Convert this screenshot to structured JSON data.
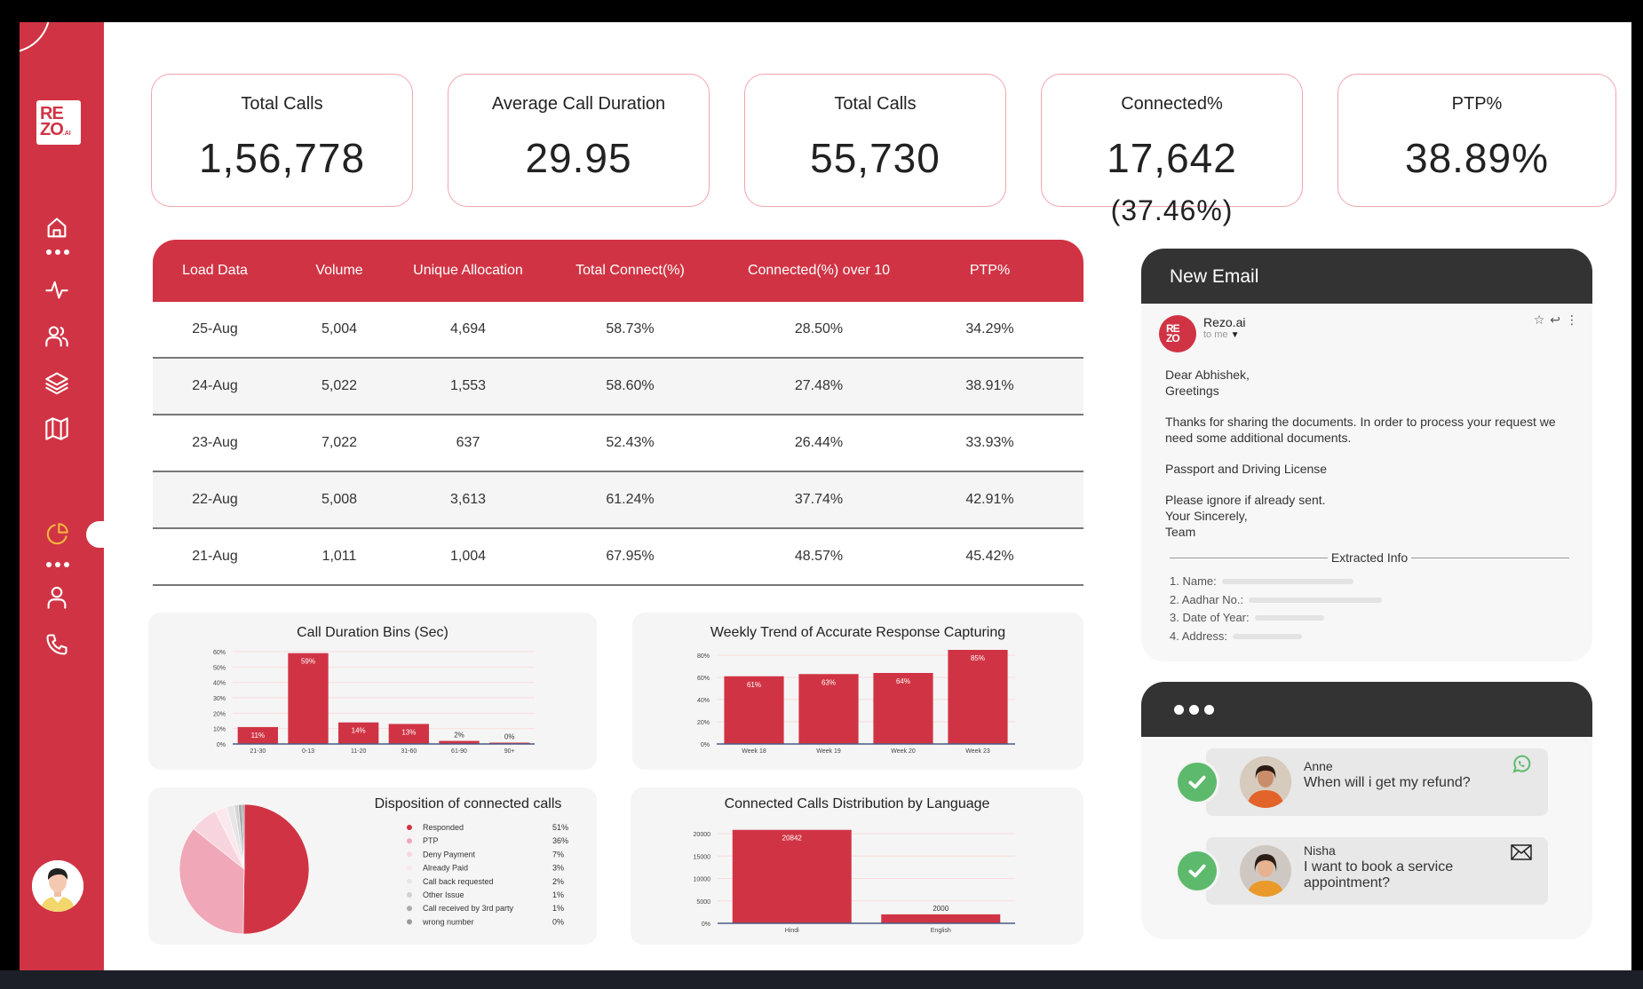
{
  "brand": {
    "logo_line1": "RE",
    "logo_line2": "ZO",
    "logo_suffix": ".AI"
  },
  "sidebar": {
    "items": [
      {
        "name": "home",
        "icon": "home-icon"
      },
      {
        "name": "more-1",
        "icon": "more-dots-icon"
      },
      {
        "name": "activity",
        "icon": "activity-pulse-icon"
      },
      {
        "name": "users",
        "icon": "users-icon"
      },
      {
        "name": "layers",
        "icon": "layers-icon"
      },
      {
        "name": "map",
        "icon": "map-icon"
      },
      {
        "name": "analytics",
        "icon": "pie-chart-icon",
        "active": true
      },
      {
        "name": "more-2",
        "icon": "more-dots-icon"
      },
      {
        "name": "profile",
        "icon": "user-icon"
      },
      {
        "name": "calls",
        "icon": "phone-icon"
      }
    ],
    "active_color": "#f5b640"
  },
  "kpis": [
    {
      "title": "Total Calls",
      "value": "1,56,778",
      "extra": ""
    },
    {
      "title": "Average Call Duration",
      "value": "29.95",
      "extra": ""
    },
    {
      "title": "Total Calls",
      "value": "55,730",
      "extra": ""
    },
    {
      "title": "Connected%",
      "value": "17,642",
      "extra": "(37.46%)"
    },
    {
      "title": "PTP%",
      "value": "38.89%",
      "extra": ""
    }
  ],
  "table": {
    "headers": [
      "Load Data",
      "Volume",
      "Unique Allocation",
      "Total Connect(%)",
      "Connected(%) over 10",
      "PTP%"
    ],
    "rows": [
      [
        "25-Aug",
        "5,004",
        "4,694",
        "58.73%",
        "28.50%",
        "34.29%"
      ],
      [
        "24-Aug",
        "5,022",
        "1,553",
        "58.60%",
        "27.48%",
        "38.91%"
      ],
      [
        "23-Aug",
        "7,022",
        "637",
        "52.43%",
        "26.44%",
        "33.93%"
      ],
      [
        "22-Aug",
        "5,008",
        "3,613",
        "61.24%",
        "37.74%",
        "42.91%"
      ],
      [
        "21-Aug",
        "1,011",
        "1,004",
        "67.95%",
        "48.57%",
        "45.42%"
      ]
    ]
  },
  "chart_data": [
    {
      "type": "bar",
      "title": "Call Duration Bins (Sec)",
      "categories": [
        "21-30",
        "0-13",
        "11-20",
        "31-60",
        "61-90",
        "90+"
      ],
      "values": [
        11,
        59,
        14,
        13,
        2,
        0
      ],
      "value_labels": [
        "11%",
        "59%",
        "14%",
        "13%",
        "2%",
        "0%"
      ],
      "yticks": [
        "0%",
        "10%",
        "20%",
        "30%",
        "40%",
        "50%",
        "60%"
      ],
      "ylim": [
        0,
        60
      ],
      "xlabel": "",
      "ylabel": "",
      "grid": true
    },
    {
      "type": "bar",
      "title": "Weekly Trend of Accurate Response Capturing",
      "categories": [
        "Week 18",
        "Week 19",
        "Week 20",
        "Week 23"
      ],
      "values": [
        61,
        63,
        64,
        85
      ],
      "value_labels": [
        "61%",
        "63%",
        "64%",
        "85%"
      ],
      "yticks": [
        "0%",
        "20%",
        "40%",
        "60%",
        "80%"
      ],
      "ylim": [
        0,
        80
      ],
      "xlabel": "",
      "ylabel": "",
      "grid": true
    },
    {
      "type": "pie",
      "title": "Disposition of connected calls",
      "legend_position": "right",
      "slices": [
        {
          "label": "Responded",
          "value": 51,
          "display": "51%",
          "color": "#d03444"
        },
        {
          "label": "PTP",
          "value": 36,
          "display": "36%",
          "color": "#f0a8b8"
        },
        {
          "label": "Deny Payment",
          "value": 7,
          "display": "7%",
          "color": "#f8d5de"
        },
        {
          "label": "Already Paid",
          "value": 3,
          "display": "3%",
          "color": "#fbe8ed"
        },
        {
          "label": "Call back requested",
          "value": 2,
          "display": "2%",
          "color": "#e6e6e6"
        },
        {
          "label": "Other Issue",
          "value": 1,
          "display": "1%",
          "color": "#d2d2d2"
        },
        {
          "label": "Call received by 3rd party",
          "value": 1,
          "display": "1%",
          "color": "#ababab"
        },
        {
          "label": "wrong number",
          "value": 0.5,
          "display": "0%",
          "color": "#999999"
        }
      ]
    },
    {
      "type": "bar",
      "title": "Connected Calls Distribution by Language",
      "categories": [
        "Hindi",
        "English"
      ],
      "values": [
        20842,
        2000
      ],
      "value_labels": [
        "20842",
        "2000"
      ],
      "yticks": [
        "0%",
        "5000",
        "10000",
        "15000",
        "20000"
      ],
      "ylim": [
        0,
        20000
      ],
      "xlabel": "",
      "ylabel": "",
      "grid": true
    }
  ],
  "email": {
    "header": "New Email",
    "sender": "Rezo.ai",
    "to": "to me",
    "greeting1": "Dear Abhishek,",
    "greeting2": "Greetings",
    "para1": "Thanks for sharing the documents. In order to process your request we need some additional documents.",
    "para2": "Passport and Driving License",
    "closing1": "Please ignore if already sent.",
    "closing2": "Your Sincerely,",
    "closing3": "Team",
    "extracted_title": "Extracted Info",
    "fields": [
      "1. Name:",
      "2. Aadhar No.:",
      "3. Date of Year:",
      "4. Address:"
    ]
  },
  "chat": {
    "messages": [
      {
        "name": "Anne",
        "text": "When will i get my refund?",
        "channel_icon": "whatsapp-icon"
      },
      {
        "name": "Nisha",
        "text": "I want to book a service appointment?",
        "channel_icon": "mail-icon"
      }
    ]
  },
  "colors": {
    "brand": "#d03444",
    "check": "#5dba6c",
    "dark_header": "#333333"
  }
}
